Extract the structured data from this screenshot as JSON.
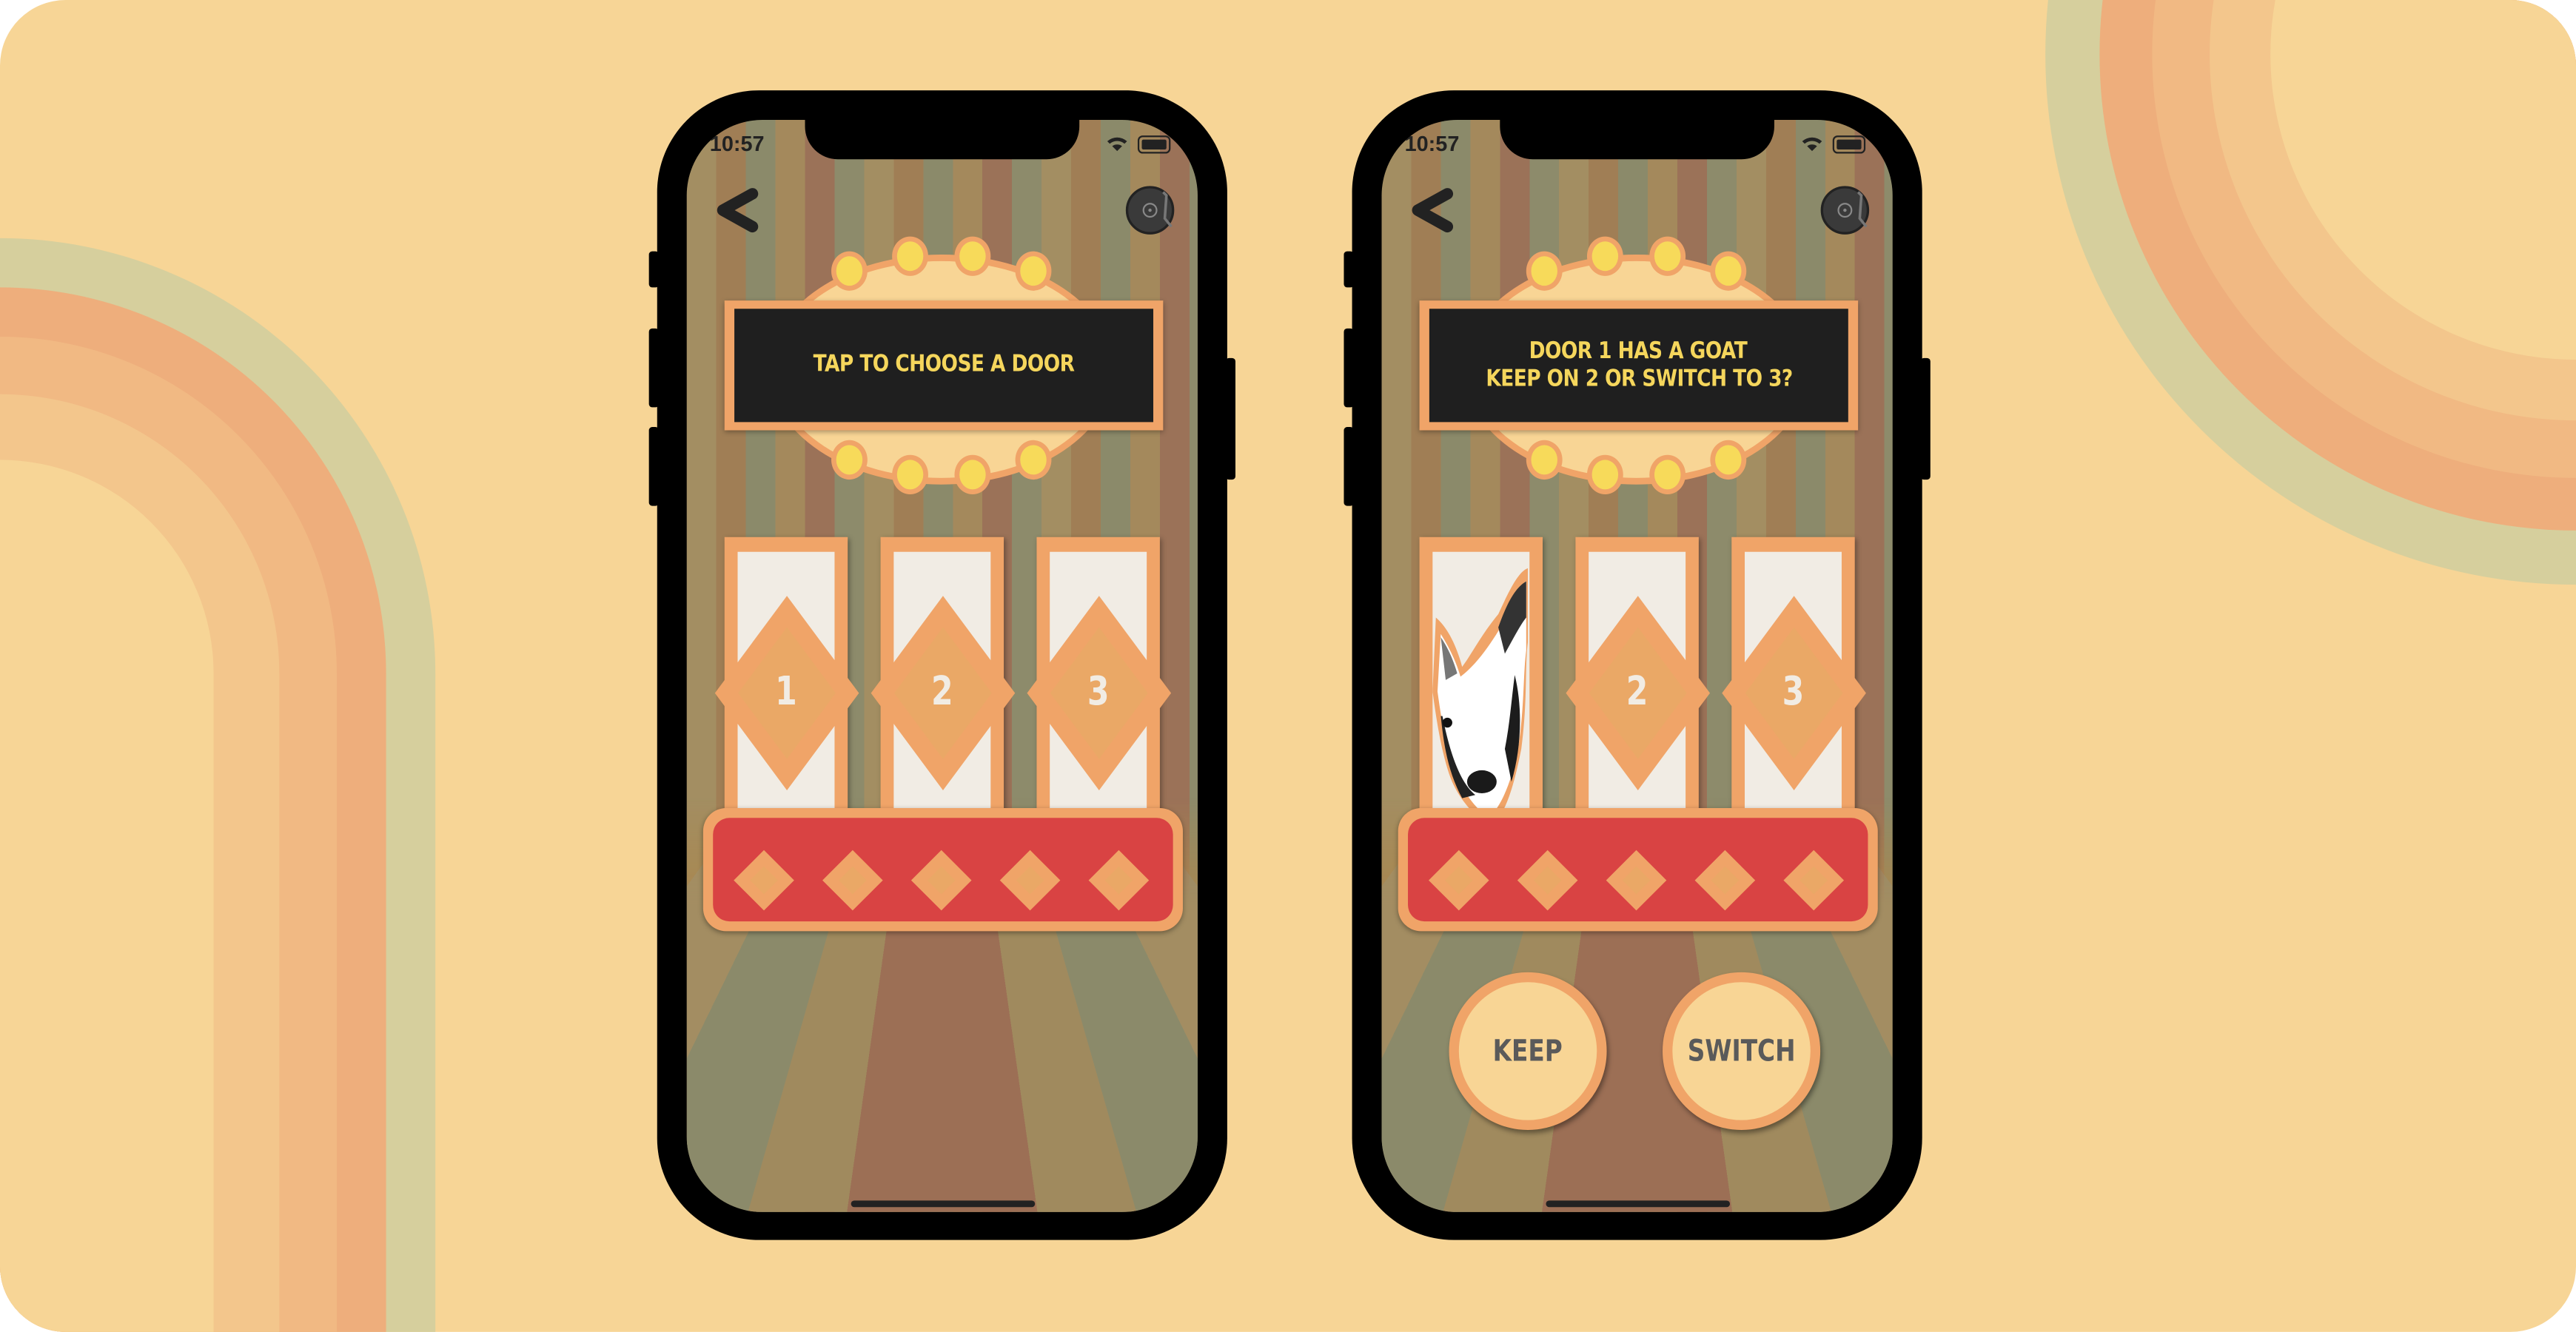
{
  "colors": {
    "background": "#f7d596",
    "accent_orange": "#f0a468",
    "base_red": "#d94343",
    "sign_black": "#1f1f1f",
    "sign_text": "#f5d65c",
    "door_cream": "#f1ece4",
    "light_yellow": "#f7da5a"
  },
  "phones": [
    {
      "status": {
        "time": "10:57",
        "icons": [
          "wifi-icon",
          "battery-icon"
        ]
      },
      "nav": {
        "back_icon": "chevron-left-icon",
        "music_icon": "record-player-icon"
      },
      "prompt": {
        "line1": "TAP TO CHOOSE A DOOR",
        "line2": ""
      },
      "doors": [
        {
          "label": "1",
          "content": "closed"
        },
        {
          "label": "2",
          "content": "closed"
        },
        {
          "label": "3",
          "content": "closed"
        }
      ]
    },
    {
      "status": {
        "time": "10:57",
        "icons": [
          "wifi-icon",
          "battery-icon"
        ]
      },
      "nav": {
        "back_icon": "chevron-left-icon",
        "music_icon": "record-player-icon"
      },
      "prompt": {
        "line1": "DOOR 1 HAS A GOAT",
        "line2": "KEEP ON 2 OR SWITCH TO 3?"
      },
      "doors": [
        {
          "label": "1",
          "content": "goat"
        },
        {
          "label": "2",
          "content": "closed"
        },
        {
          "label": "3",
          "content": "closed"
        }
      ],
      "buttons": {
        "keep": "KEEP",
        "switch": "SWITCH"
      }
    }
  ]
}
